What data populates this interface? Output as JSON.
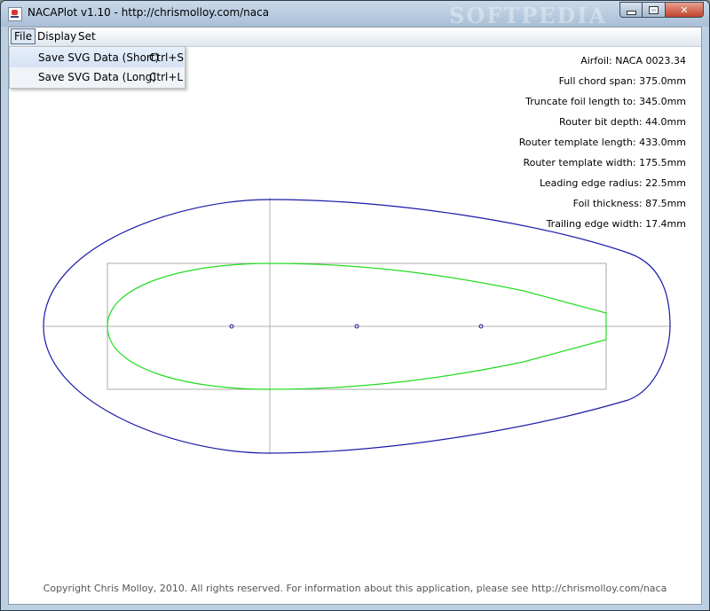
{
  "window": {
    "title": "NACAPlot v1.10 - http://chrismolloy.com/naca",
    "watermark": "SOFTPEDIA",
    "minimize_icon": "minimize-icon",
    "maximize_icon": "maximize-icon",
    "close_icon": "close-icon",
    "close_glyph": "✕"
  },
  "menu": {
    "items": [
      {
        "label": "File"
      },
      {
        "label": "Display"
      },
      {
        "label": "Set"
      }
    ],
    "file_dropdown": [
      {
        "label": "Save SVG Data (Short)",
        "accel": "Ctrl+S"
      },
      {
        "label": "Save SVG Data (Long)",
        "accel": "Ctrl+L"
      }
    ]
  },
  "info": [
    "Airfoil: NACA 0023.34",
    "Full chord span: 375.0mm",
    "Truncate foil length to: 345.0mm",
    "Router bit depth: 44.0mm",
    "Router template length: 433.0mm",
    "Router template width: 175.5mm",
    "Leading edge radius: 22.5mm",
    "Foil thickness: 87.5mm",
    "Trailing edge width: 17.4mm"
  ],
  "footer": {
    "copyright": "Copyright Chris Molloy, 2010. All rights reserved. For information about this application, please see http://chrismolloy.com/naca"
  },
  "colors": {
    "foil": "#22dd22",
    "template": "#1a1aa8",
    "axis": "#b0b0b0",
    "bbox": "#a8a8a8",
    "points": "#1a1aa8"
  }
}
